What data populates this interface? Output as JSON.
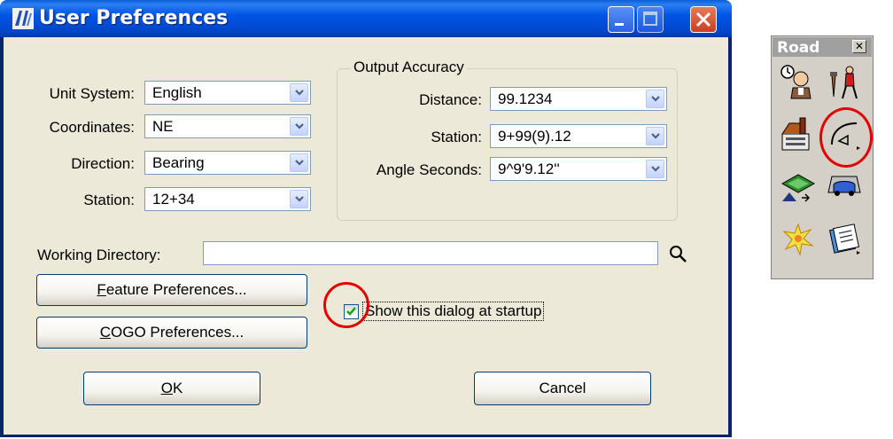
{
  "dialog": {
    "title": "User Preferences",
    "unit_system": {
      "label": "Unit System:",
      "value": "English"
    },
    "coordinates": {
      "label": "Coordinates:",
      "value": "NE"
    },
    "direction": {
      "label": "Direction:",
      "value": "Bearing"
    },
    "station": {
      "label": "Station:",
      "value": "12+34"
    },
    "output_accuracy": {
      "title": "Output Accuracy",
      "distance": {
        "label": "Distance:",
        "value": "99.1234"
      },
      "station": {
        "label": "Station:",
        "value": "9+99(9).12"
      },
      "angle_seconds": {
        "label": "Angle Seconds:",
        "value": "9^9'9.12''"
      }
    },
    "working_directory": {
      "label": "Working Directory:",
      "value": ""
    },
    "feature_preferences_button": {
      "mnemonic": "F",
      "rest": "eature Preferences..."
    },
    "cogo_preferences_button": {
      "mnemonic": "C",
      "rest": "OGO Preferences..."
    },
    "show_at_startup": {
      "label": "Show this dialog at startup",
      "checked": true
    },
    "ok_button": {
      "mnemonic": "O",
      "rest": "K"
    },
    "cancel_button": "Cancel"
  },
  "road_toolbar": {
    "title": "Road",
    "close_glyph": "✕",
    "tools": [
      "project-manager-icon",
      "survey-icon",
      "preferences-icon",
      "horizontal-curve-icon",
      "surface-icon",
      "roadway-designer-icon",
      "highlight-icon",
      "reports-icon"
    ]
  },
  "colors": {
    "highlight_circle": "#e20000",
    "title_bar": "#0055e5",
    "dialog_face": "#ece9d8"
  }
}
